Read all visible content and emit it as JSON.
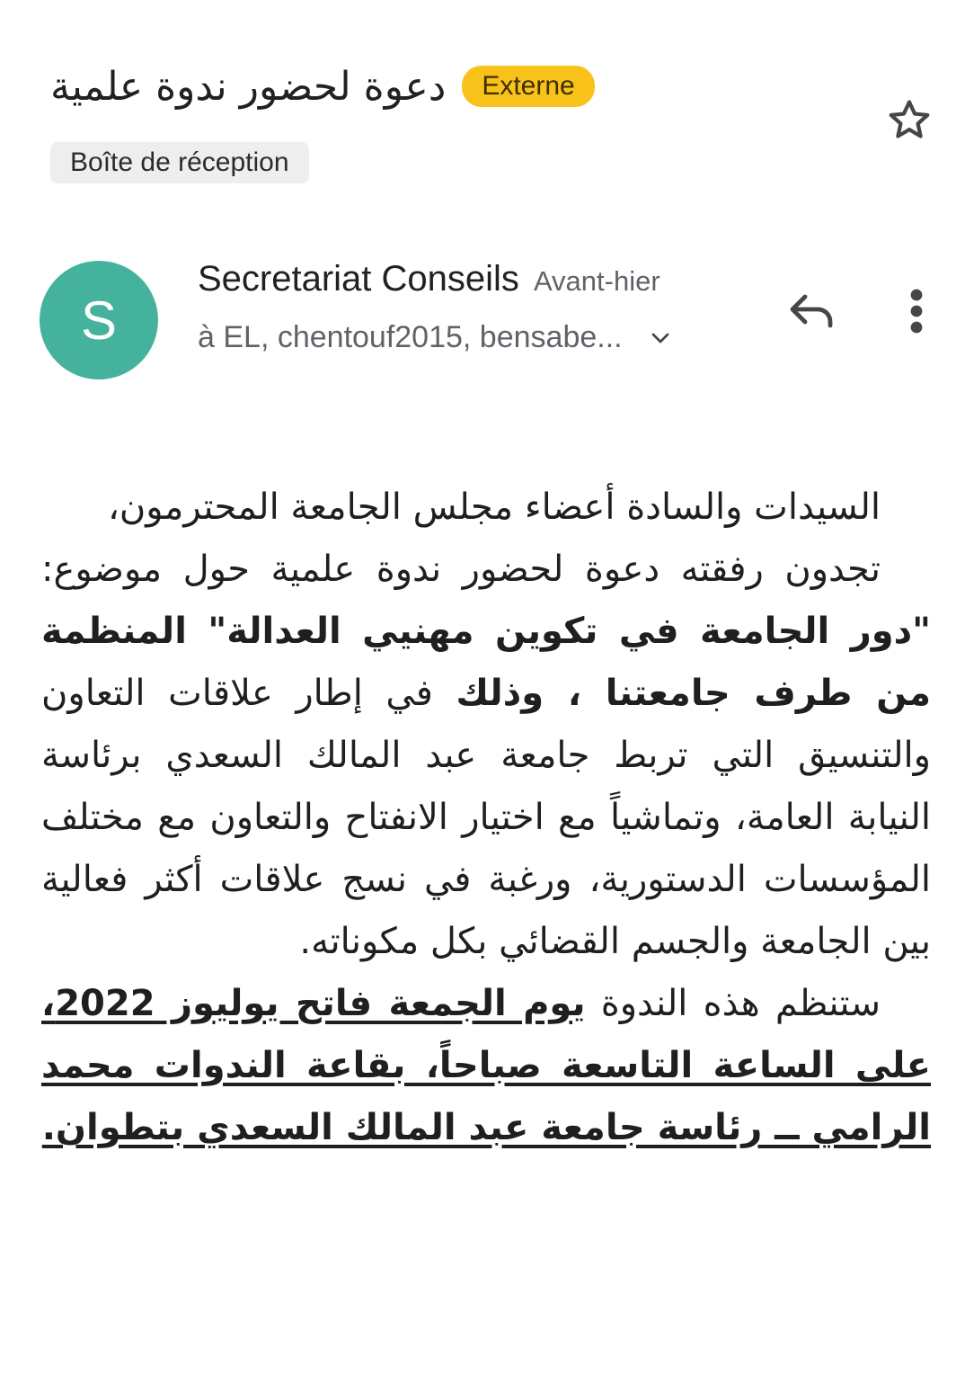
{
  "header": {
    "subject": "دعوة لحضور ندوة علمية",
    "external_badge": "Externe",
    "label_chip": "Boîte de réception",
    "star_icon": "star-outline-icon"
  },
  "sender": {
    "avatar_letter": "S",
    "avatar_color": "#45b29d",
    "name": "Secretariat Conseils",
    "date": "Avant-hier",
    "recipients": "à EL, chentouf2015, bensabe...",
    "expand_icon": "chevron-down-icon",
    "reply_icon": "reply-icon",
    "more_icon": "more-vert-icon"
  },
  "body": {
    "greeting": "السيدات والسادة أعضاء مجلس الجامعة المحترمون،",
    "p2_a": "تجدون رفقته دعوة لحضور ندوة علمية حول موضوع: ",
    "p2_b": "\"دور الجامعة في تكوين مهنيي العدالة\" المنظمة من طرف جامعتنا ، وذلك",
    "p2_c": " في إطار علاقات التعاون والتنسيق التي تربط جامعة عبد المالك السعدي برئاسة النيابة العامة، وتماشياً مع اختيار الانفتاح والتعاون مع مختلف المؤسسات الدستورية، ورغبة في نسج علاقات أكثر فعالية بين الجامعة والجسم القضائي بكل مكوناته.",
    "p3_a": "ستنظم هذه الندوة ",
    "p3_b": "يوم الجمعة فاتح يوليوز 2022، على الساعة التاسعة صباحاً، بقاعة الندوات محمد الرامي ــ رئاسة جامعة عبد المالك السعدي بتطوان."
  },
  "colors": {
    "badge": "#f9c21a",
    "chip": "#eeeeee",
    "secondary_text": "#5f6368"
  }
}
